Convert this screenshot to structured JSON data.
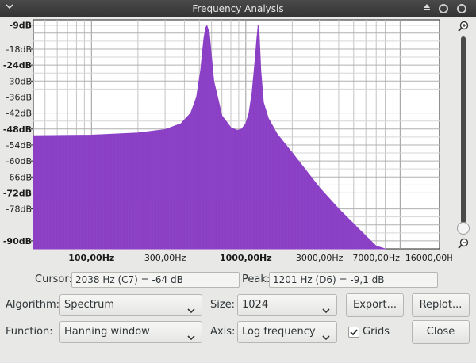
{
  "window": {
    "title": "Frequency Analysis"
  },
  "chart_data": {
    "type": "area",
    "title": "",
    "xlabel": "",
    "ylabel": "",
    "x_scale": "log",
    "xlim": [
      42,
      18000
    ],
    "ylim": [
      -93,
      -7
    ],
    "grid": true,
    "fill_color": "#8a3fc4",
    "x": [
      42,
      100,
      200,
      300,
      380,
      440,
      480,
      510,
      535,
      550,
      560,
      580,
      620,
      700,
      800,
      880,
      940,
      1000,
      1050,
      1100,
      1150,
      1180,
      1200,
      1201,
      1220,
      1250,
      1300,
      1400,
      1600,
      2000,
      3000,
      4000,
      5500,
      7000,
      8000
    ],
    "y": [
      -50.5,
      -50.3,
      -49.5,
      -48.2,
      -46,
      -42,
      -36,
      -26,
      -14,
      -10,
      -9.2,
      -12,
      -30,
      -43,
      -47.5,
      -48.5,
      -48,
      -46,
      -42,
      -34,
      -22,
      -14,
      -10,
      -9.1,
      -12,
      -26,
      -38,
      -44,
      -50,
      -57,
      -70,
      -78,
      -86,
      -92,
      -93
    ],
    "y_ticks": [
      {
        "label": "-9dB",
        "value": -9,
        "bold": true
      },
      {
        "label": "-18dB",
        "value": -18,
        "bold": false
      },
      {
        "label": "-24dB",
        "value": -24,
        "bold": true
      },
      {
        "label": "-30dB",
        "value": -30,
        "bold": false
      },
      {
        "label": "-36dB",
        "value": -36,
        "bold": false
      },
      {
        "label": "-42dB",
        "value": -42,
        "bold": false
      },
      {
        "label": "-48dB",
        "value": -48,
        "bold": true
      },
      {
        "label": "-54dB",
        "value": -54,
        "bold": false
      },
      {
        "label": "-60dB",
        "value": -60,
        "bold": false
      },
      {
        "label": "-66dB",
        "value": -66,
        "bold": false
      },
      {
        "label": "-72dB",
        "value": -72,
        "bold": true
      },
      {
        "label": "-78dB",
        "value": -78,
        "bold": false
      },
      {
        "label": "-90dB",
        "value": -90,
        "bold": true
      }
    ],
    "x_ticks": [
      {
        "label": "100,00Hz",
        "value": 100,
        "bold": true
      },
      {
        "label": "300,00Hz",
        "value": 300,
        "bold": false
      },
      {
        "label": "1000,00Hz",
        "value": 1000,
        "bold": true
      },
      {
        "label": "3000,00Hz",
        "value": 3000,
        "bold": false
      },
      {
        "label": "7000,00Hz",
        "value": 7000,
        "bold": false
      },
      {
        "label": "16000,00Hz",
        "value": 16000,
        "bold": false
      }
    ]
  },
  "readouts": {
    "cursor_label": "Cursor:",
    "cursor_value": "2038 Hz (C7) = -64 dB",
    "peak_label": "Peak:",
    "peak_value": "1201 Hz (D6) = -9,1 dB"
  },
  "controls": {
    "algorithm_label": "Algorithm:",
    "algorithm_value": "Spectrum",
    "size_label": "Size:",
    "size_value": "1024",
    "function_label": "Function:",
    "function_value": "Hanning window",
    "axis_label": "Axis:",
    "axis_value": "Log frequency",
    "grids_label": "Grids",
    "grids_checked": true,
    "export_label": "Export...",
    "replot_label": "Replot...",
    "close_label": "Close"
  },
  "icons": {
    "collapse": "chevron-down-icon",
    "shade": "triangle-up-icon",
    "minimize": "circle-icon",
    "close": "circle-icon",
    "zoom_in": "zoom-in-icon",
    "zoom_out": "zoom-out-icon"
  }
}
